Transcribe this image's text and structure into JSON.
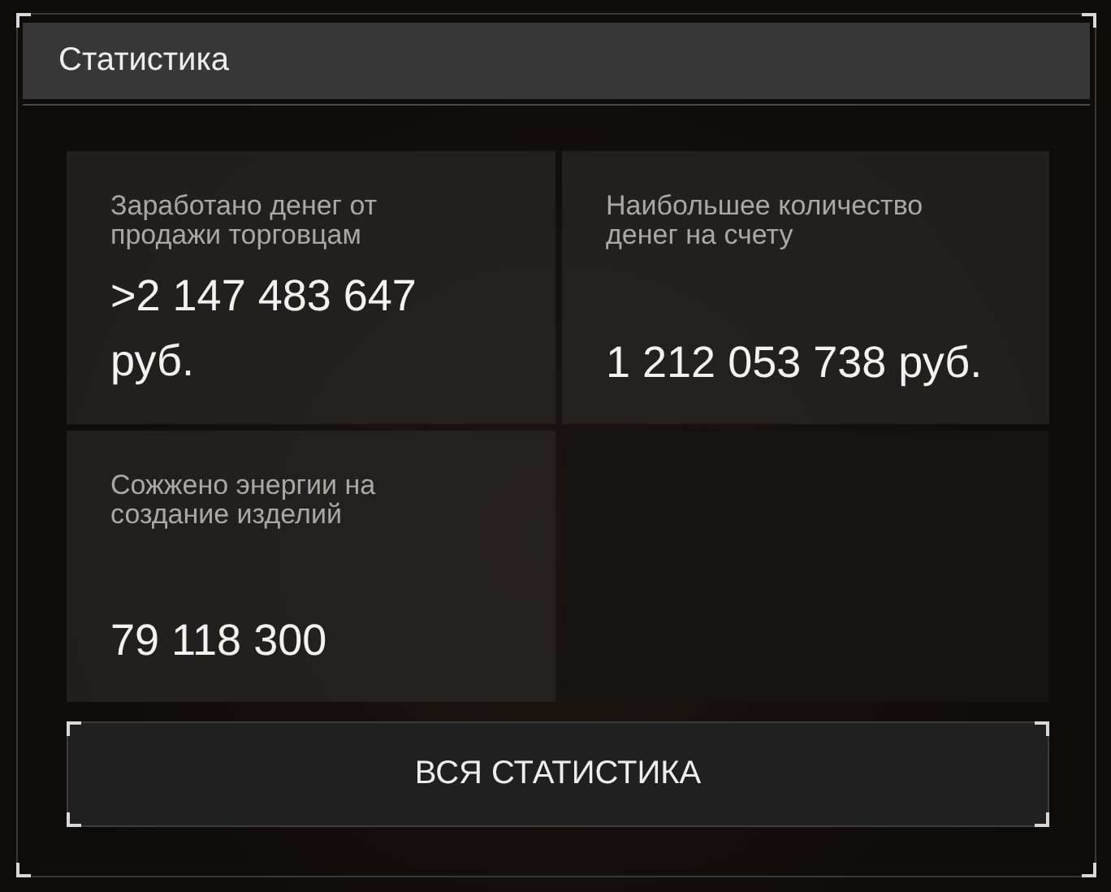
{
  "window": {
    "title": "Статистика"
  },
  "stats": [
    {
      "kind": "stat",
      "label": "Заработано денег от продажи торговцам",
      "value": ">2 147 483 647 руб."
    },
    {
      "kind": "stat",
      "label": "Наибольшее количество денег на счету",
      "value": "1 212 053 738 руб."
    },
    {
      "kind": "stat",
      "label": "Сожжено энергии на создание изделий",
      "value": "79 118 300"
    },
    {
      "kind": "empty"
    }
  ],
  "button": {
    "label": "ВСЯ СТАТИСТИКА"
  }
}
